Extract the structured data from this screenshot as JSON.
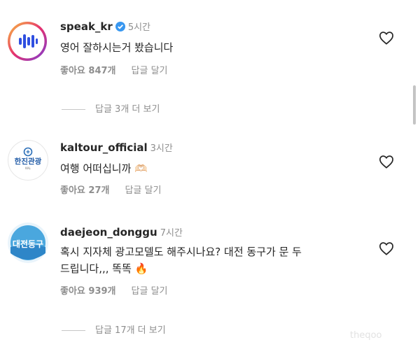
{
  "comments": [
    {
      "username": "speak_kr",
      "verified": true,
      "time": "5시간",
      "text": "영어 잘하시는거 봤습니다",
      "likes": "좋아요 847개",
      "reply_label": "답글 달기",
      "more_replies": "답글 3개 더 보기"
    },
    {
      "username": "kaltour_official",
      "time": "3시간",
      "text": "여행 어떠십니까 🫶🏻",
      "likes": "좋아요 27개",
      "reply_label": "답글 달기",
      "avatar_text": "한진관광",
      "avatar_subtext": "KAL"
    },
    {
      "username": "daejeon_donggu",
      "time": "7시간",
      "text_line1": "혹시 지자체 광고모델도 해주시나요? 대전 동구가 문 두",
      "text_line2": "드립니다,,, 똑똑 🔥",
      "likes": "좋아요 939개",
      "reply_label": "답글 달기",
      "more_replies": "답글 17개 더 보기",
      "avatar_text": "대전동구"
    }
  ],
  "watermark": "theqoo",
  "colors": {
    "muted": "#8e8e8e",
    "text": "#262626",
    "verified": "#3897f0"
  }
}
